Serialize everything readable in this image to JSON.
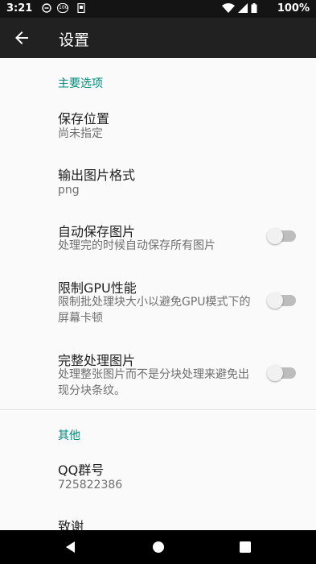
{
  "status_bar": {
    "time": "3:21",
    "icons": [
      "sync-icon",
      "data-saver-icon",
      "notification-icon",
      "wifi-icon",
      "cellular-icon",
      "battery-icon"
    ],
    "data_saver_badge": "100",
    "battery": "100%"
  },
  "app_bar": {
    "back_icon": "arrow-back-icon",
    "title": "设置"
  },
  "sections": {
    "main": {
      "header": "主要选项",
      "save_location": {
        "title": "保存位置",
        "summary": "尚未指定"
      },
      "output_format": {
        "title": "输出图片格式",
        "summary": "png"
      },
      "auto_save": {
        "title": "自动保存图片",
        "summary": "处理完的时候自动保存所有图片",
        "checked": false
      },
      "limit_gpu": {
        "title": "限制GPU性能",
        "summary": "限制批处理块大小以避免GPU模式下的屏幕卡顿",
        "checked": false
      },
      "full_process": {
        "title": "完整处理图片",
        "summary": "处理整张图片而不是分块处理来避免出现分块条纹。",
        "checked": false
      }
    },
    "other": {
      "header": "其他",
      "qq_group": {
        "title": "QQ群号",
        "summary": "725822386"
      },
      "thanks": {
        "title": "致谢"
      }
    }
  },
  "colors": {
    "accent": "#00897b",
    "app_bar": "#212121",
    "status_bar": "#141414",
    "background": "#fafafa",
    "switch_track_off": "#bdbdbd",
    "switch_thumb_off": "#f1f1f1"
  },
  "nav_bar": {
    "back_icon": "nav-back-icon",
    "home_icon": "nav-home-icon",
    "recents_icon": "nav-recents-icon"
  }
}
